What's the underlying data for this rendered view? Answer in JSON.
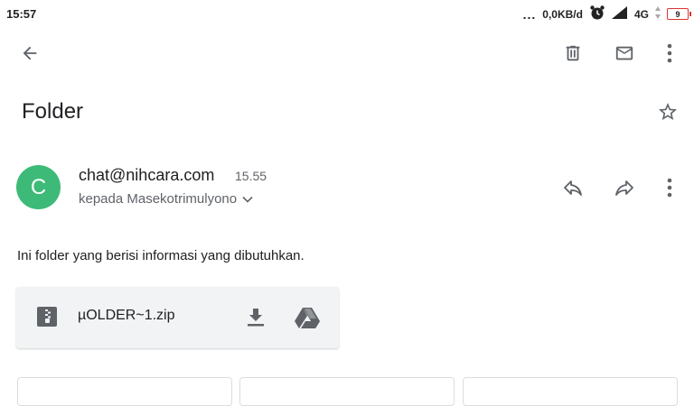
{
  "status_bar": {
    "time": "15:57",
    "dots": "...",
    "network_speed": "0,0KB/d",
    "network_type": "4G",
    "battery_level": "9"
  },
  "email": {
    "subject": "Folder",
    "avatar_letter": "C",
    "sender": "chat@nihcara.com",
    "time": "15.55",
    "recipient": "kepada Masekotrimulyono",
    "body": "Ini folder yang berisi informasi yang dibutuhkan.",
    "attachment": {
      "name": "µOLDER~1.zip"
    }
  },
  "colors": {
    "avatar": "#3dba77",
    "icon": "#5f6368",
    "attachment_bg": "#f1f3f4"
  }
}
